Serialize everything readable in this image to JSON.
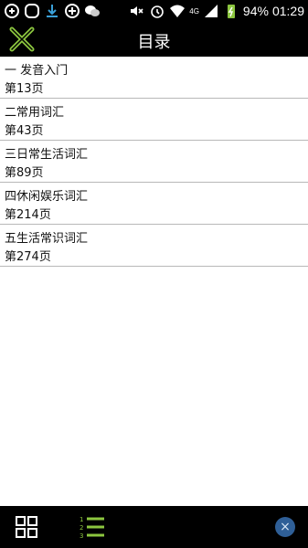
{
  "status_bar": {
    "battery": "94%",
    "time": "01:29",
    "network": "4G"
  },
  "header": {
    "title": "目录"
  },
  "toc": {
    "items": [
      {
        "title": "一 发音入门",
        "page": "第13页"
      },
      {
        "title": "二常用词汇",
        "page": "第43页"
      },
      {
        "title": "三日常生活词汇",
        "page": "第89页"
      },
      {
        "title": "四休闲娱乐词汇",
        "page": "第214页"
      },
      {
        "title": "五生活常识词汇",
        "page": "第274页"
      }
    ]
  },
  "bottom_bar": {
    "list_numbers": [
      "1",
      "2",
      "3"
    ],
    "dismiss_label": "×"
  },
  "colors": {
    "accent": "#8cc63f",
    "bar_bg": "#000000",
    "divider": "#b8b8b8",
    "dismiss_bg": "#2f5f97"
  }
}
